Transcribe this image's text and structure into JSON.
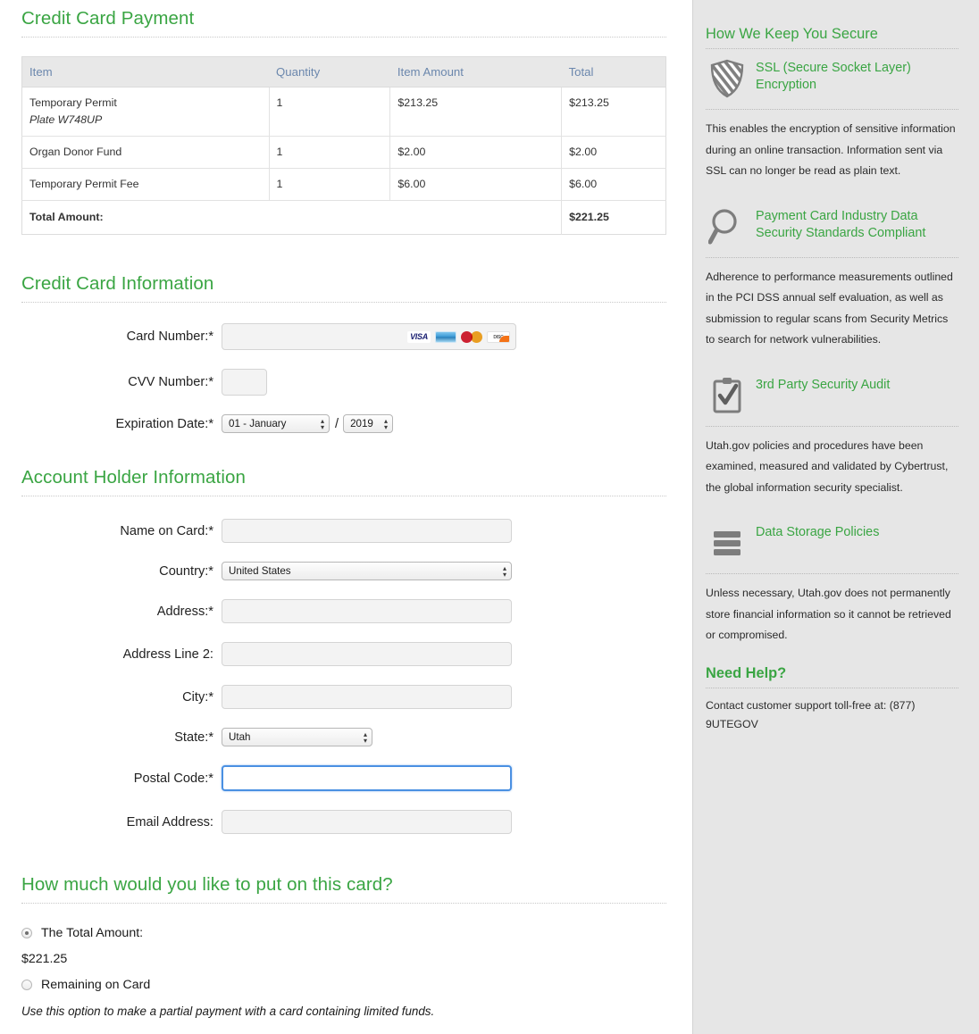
{
  "main": {
    "page_title": "Credit Card Payment",
    "order_table": {
      "headers": [
        "Item",
        "Quantity",
        "Item Amount",
        "Total"
      ],
      "rows": [
        {
          "item": "Temporary Permit",
          "sub": "Plate W748UP",
          "qty": "1",
          "amount": "$213.25",
          "total": "$213.25"
        },
        {
          "item": "Organ Donor Fund",
          "sub": "",
          "qty": "1",
          "amount": "$2.00",
          "total": "$2.00"
        },
        {
          "item": "Temporary Permit Fee",
          "sub": "",
          "qty": "1",
          "amount": "$6.00",
          "total": "$6.00"
        }
      ],
      "total_label": "Total Amount:",
      "total_value": "$221.25"
    },
    "card_section": {
      "title": "Credit Card Information",
      "card_number_label": "Card Number:*",
      "card_number_value": "",
      "accepted_cards": [
        "VISA",
        "American Express",
        "MasterCard",
        "Discover"
      ],
      "visa_text": "VISA",
      "discover_text": "DISCOVER",
      "cvv_label": "CVV Number:*",
      "cvv_value": "",
      "expiration_label": "Expiration Date:*",
      "expiration_month": "01 - January",
      "expiration_year": "2019",
      "separator": "/"
    },
    "holder_section": {
      "title": "Account Holder Information",
      "name_label": "Name on Card:*",
      "name_value": "",
      "country_label": "Country:*",
      "country_value": "United States",
      "address_label": "Address:*",
      "address_value": "",
      "address2_label": "Address Line 2:",
      "address2_value": "",
      "city_label": "City:*",
      "city_value": "",
      "state_label": "State:*",
      "state_value": "Utah",
      "postal_label": "Postal Code:*",
      "postal_value": "",
      "email_label": "Email Address:",
      "email_value": ""
    },
    "amount_section": {
      "title": "How much would you like to put on this card?",
      "option_total_label": "The Total Amount:",
      "option_total_amount": "$221.25",
      "option_remaining_label": "Remaining on Card",
      "hint": "Use this option to make a partial payment with a card containing limited funds."
    }
  },
  "sidebar": {
    "secure_title": "How We Keep You Secure",
    "items": [
      {
        "icon": "shield-icon",
        "title": "SSL (Secure Socket Layer) Encryption",
        "text": "This enables the encryption of sensitive information during an online transaction. Information sent via SSL can no longer be read as plain text."
      },
      {
        "icon": "search-icon",
        "title": "Payment Card Industry Data Security Standards Compliant",
        "text": "Adherence to performance measurements outlined in the PCI DSS annual self evaluation, as well as submission to regular scans from Security Metrics to search for network vulnerabilities."
      },
      {
        "icon": "clipboard-icon",
        "title": "3rd Party Security Audit",
        "text": "Utah.gov policies and procedures have been examined, measured and validated by Cybertrust, the global information security specialist."
      },
      {
        "icon": "storage-icon",
        "title": "Data Storage Policies",
        "text": "Unless necessary, Utah.gov does not permanently store financial information so it cannot be retrieved or compromised."
      }
    ],
    "help_title": "Need Help?",
    "help_text": "Contact customer support toll-free at: (877) 9UTEGOV"
  },
  "colors": {
    "accent_green": "#3aa543",
    "header_blue": "#6b87ad",
    "sidebar_bg": "#e6e6e6",
    "focus_blue": "#4a90e2"
  }
}
